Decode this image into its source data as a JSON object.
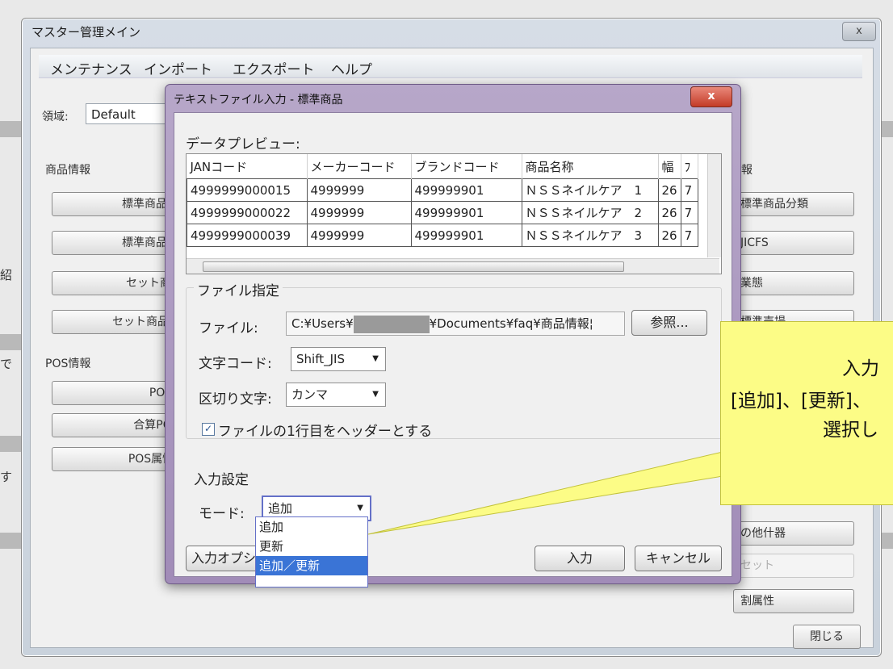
{
  "main_window": {
    "title": "マスター管理メイン",
    "close_label": "x",
    "menu": [
      "メンテナンス",
      "インポート",
      "エクスポート",
      "ヘルプ"
    ],
    "region_label": "領域:",
    "region_value": "Default",
    "product_info_label": "商品情報",
    "pos_info_label": "POS情報",
    "right_section_label": "報",
    "left_buttons": [
      "標準商品",
      "標準商品",
      "セット商",
      "セット商品",
      "POS",
      "合算PO",
      "POS属性"
    ],
    "right_buttons": [
      "標準商品分類",
      "JICFS",
      "業態",
      "標準売場",
      "の他什器",
      "セット",
      "割属性"
    ],
    "close_button": "閉じる",
    "edge_text": [
      "紹",
      "で",
      "す"
    ]
  },
  "dialog": {
    "title": "テキストファイル入力 - 標準商品",
    "close_label": "x",
    "preview_label": "データプレビュー:",
    "columns": [
      "JANコード",
      "メーカーコード",
      "ブランドコード",
      "商品名称",
      "幅",
      "ﾌ"
    ],
    "rows": [
      [
        "4999999000015",
        "4999999",
        "499999901",
        "ＮＳＳネイルケア　1",
        "26",
        "7"
      ],
      [
        "4999999000022",
        "4999999",
        "499999901",
        "ＮＳＳネイルケア　2",
        "26",
        "7"
      ],
      [
        "4999999000039",
        "4999999",
        "499999901",
        "ＮＳＳネイルケア　3",
        "26",
        "7"
      ]
    ],
    "file_group_label": "ファイル指定",
    "file_label": "ファイル:",
    "file_path_prefix": "C:¥Users¥",
    "file_path_suffix": "¥Documents¥faq¥商品情報¦",
    "browse_button": "参照...",
    "encoding_label": "文字コード:",
    "encoding_value": "Shift_JIS",
    "delimiter_label": "区切り文字:",
    "delimiter_value": "カンマ",
    "header_checkbox_label": "ファイルの1行目をヘッダーとする",
    "header_checked": true,
    "input_settings_label": "入力設定",
    "mode_label": "モード:",
    "mode_value": "追加",
    "mode_options": [
      "追加",
      "更新",
      "追加／更新"
    ],
    "mode_selected_index": 2,
    "input_options_button": "入力オプシ",
    "input_button": "入力",
    "cancel_button": "キャンセル"
  },
  "callout": {
    "line1": "入力",
    "line2": "[追加]、[更新]、",
    "line3": "選択し"
  }
}
